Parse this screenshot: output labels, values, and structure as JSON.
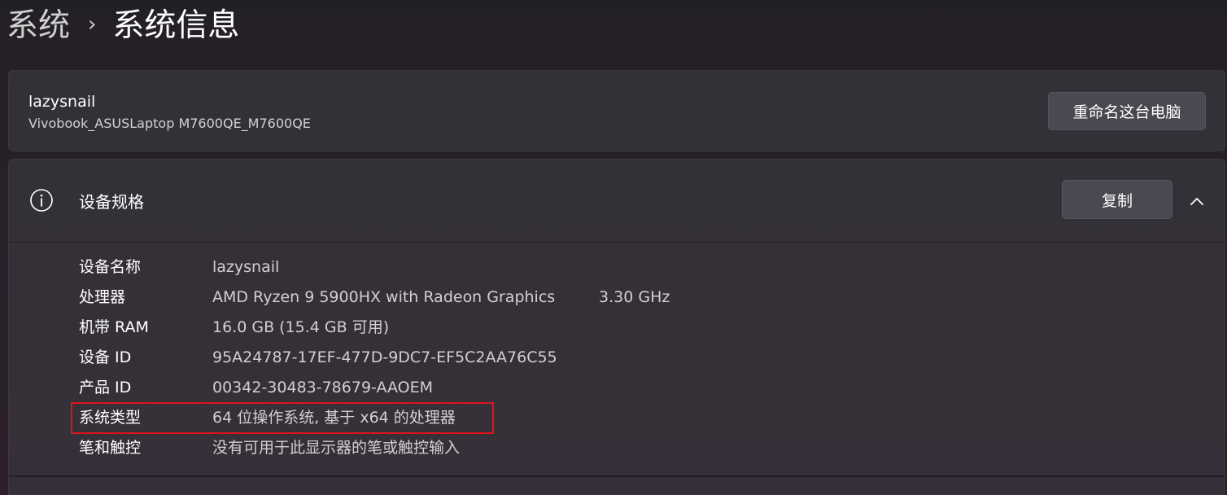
{
  "breadcrumb": {
    "parent": "系统",
    "separator": "›",
    "current": "系统信息"
  },
  "pc": {
    "name": "lazysnail",
    "model": "Vivobook_ASUSLaptop M7600QE_M7600QE",
    "rename_label": "重命名这台电脑"
  },
  "specs": {
    "icon": "info-icon",
    "title": "设备规格",
    "copy_label": "复制",
    "expanded": true,
    "rows": [
      {
        "label": "设备名称",
        "value": "lazysnail"
      },
      {
        "label": "处理器",
        "value": "AMD Ryzen 9 5900HX with Radeon Graphics",
        "extra": "3.30 GHz"
      },
      {
        "label": "机带 RAM",
        "value": "16.0 GB (15.4 GB 可用)"
      },
      {
        "label": "设备 ID",
        "value": "95A24787-17EF-477D-9DC7-EF5C2AA76C55"
      },
      {
        "label": "产品 ID",
        "value": "00342-30483-78679-AAOEM"
      },
      {
        "label": "系统类型",
        "value": "64 位操作系统, 基于 x64 的处理器"
      },
      {
        "label": "笔和触控",
        "value": "没有可用于此显示器的笔或触控输入"
      }
    ]
  },
  "colors": {
    "highlight": "#e0121b",
    "card": "#3a363e"
  }
}
